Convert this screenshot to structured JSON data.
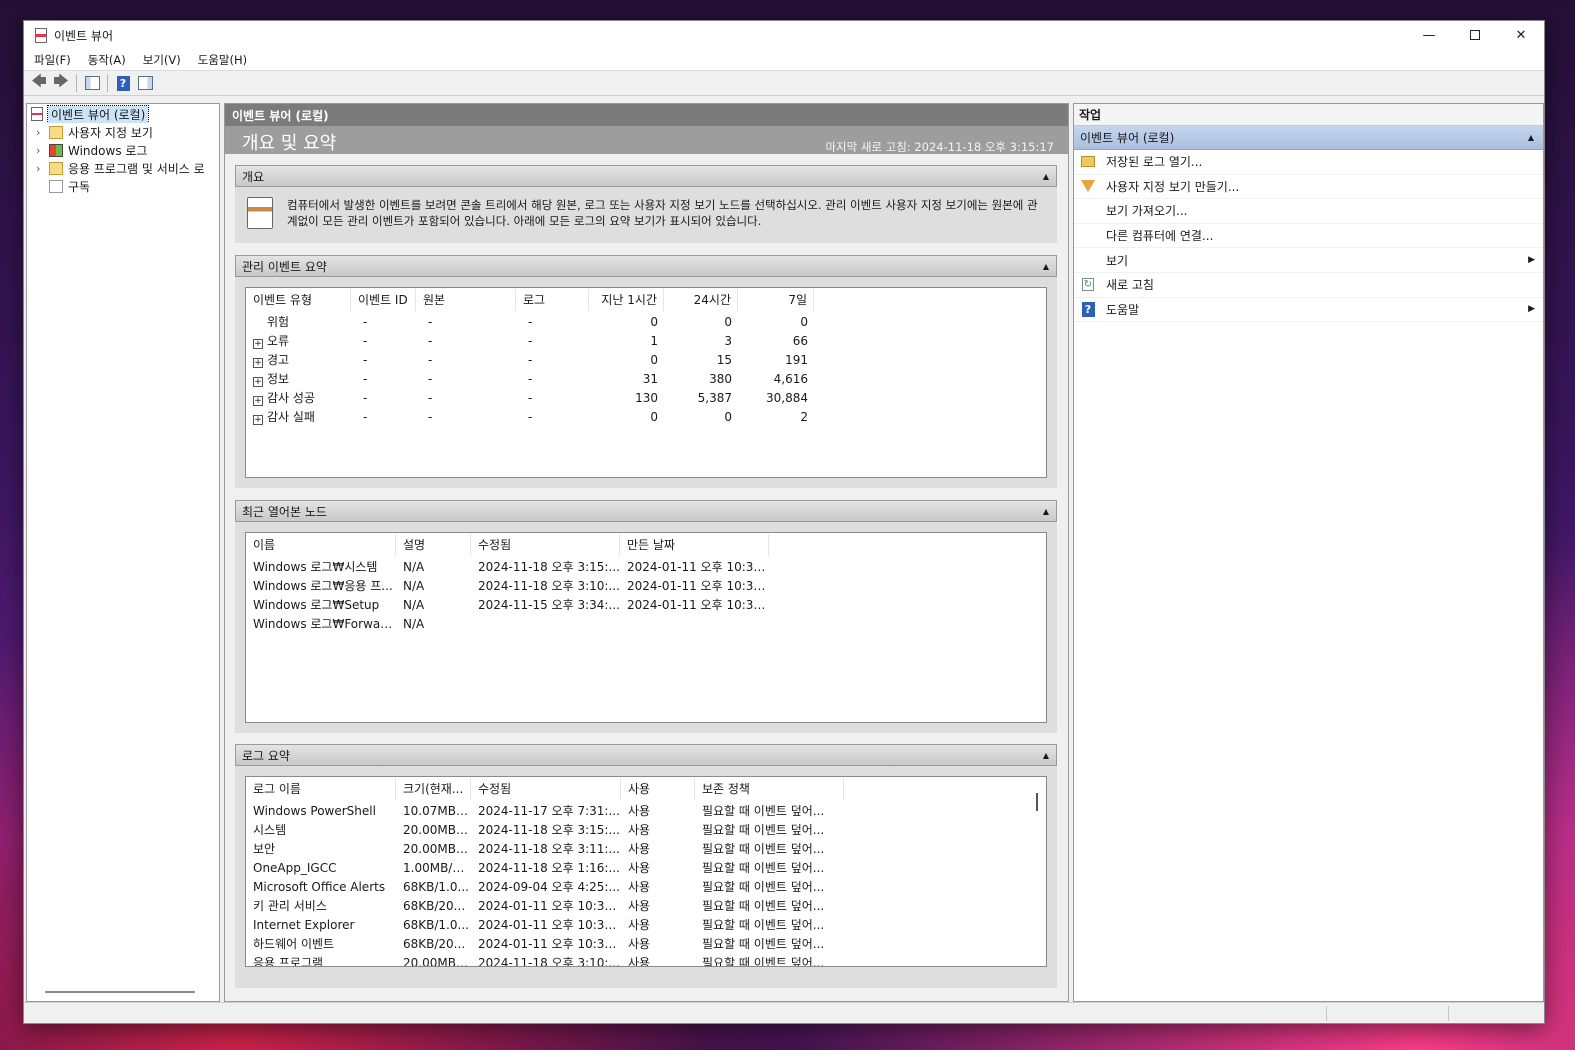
{
  "window": {
    "title": "이벤트 뷰어"
  },
  "menu": [
    "파일(F)",
    "동작(A)",
    "보기(V)",
    "도움말(H)"
  ],
  "tree": [
    {
      "label": "이벤트 뷰어 (로컬)",
      "selected": true,
      "icon": "event-viewer-icon"
    },
    {
      "label": "사용자 지정 보기",
      "icon": "folder-icon"
    },
    {
      "label": "Windows 로그",
      "icon": "windows-logs-icon"
    },
    {
      "label": "응용 프로그램 및 서비스 로",
      "icon": "folder-icon"
    },
    {
      "label": "구독",
      "icon": "subscription-icon"
    }
  ],
  "main": {
    "header": "이벤트 뷰어 (로컬)",
    "subtitle": "개요 및 요약",
    "last_refresh": "마지막 새로 고침: 2024-11-18 오후 3:15:17",
    "overview": {
      "title": "개요",
      "text": "컴퓨터에서 발생한 이벤트를 보려면 콘솔 트리에서 해당 원본, 로그 또는 사용자 지정 보기 노드를 선택하십시오. 관리 이벤트 사용자 지정 보기에는 원본에 관계없이 모든 관리 이벤트가 포함되어 있습니다. 아래에 모든 로그의 요약 보기가 표시되어 있습니다."
    },
    "admin_summary": {
      "title": "관리 이벤트 요약",
      "columns": [
        "이벤트 유형",
        "이벤트 ID",
        "원본",
        "로그",
        "지난 1시간",
        "24시간",
        "7일"
      ],
      "rows": [
        {
          "expand": false,
          "cells": [
            "위험",
            "-",
            "-",
            "-",
            "0",
            "0",
            "0"
          ]
        },
        {
          "expand": true,
          "cells": [
            "오류",
            "-",
            "-",
            "-",
            "1",
            "3",
            "66"
          ]
        },
        {
          "expand": true,
          "cells": [
            "경고",
            "-",
            "-",
            "-",
            "0",
            "15",
            "191"
          ]
        },
        {
          "expand": true,
          "cells": [
            "정보",
            "-",
            "-",
            "-",
            "31",
            "380",
            "4,616"
          ]
        },
        {
          "expand": true,
          "cells": [
            "감사 성공",
            "-",
            "-",
            "-",
            "130",
            "5,387",
            "30,884"
          ]
        },
        {
          "expand": true,
          "cells": [
            "감사 실패",
            "-",
            "-",
            "-",
            "0",
            "0",
            "2"
          ]
        }
      ]
    },
    "recent_nodes": {
      "title": "최근 열어본 노드",
      "columns": [
        "이름",
        "설명",
        "수정됨",
        "만든 날짜"
      ],
      "rows": [
        [
          "Windows 로그₩시스템",
          "N/A",
          "2024-11-18 오후 3:15:...",
          "2024-01-11 오후 10:34..."
        ],
        [
          "Windows 로그₩응용 프...",
          "N/A",
          "2024-11-18 오후 3:10:...",
          "2024-01-11 오후 10:34..."
        ],
        [
          "Windows 로그₩Setup",
          "N/A",
          "2024-11-15 오후 3:34:...",
          "2024-01-11 오후 10:36..."
        ],
        [
          "Windows 로그₩Forward...",
          "N/A",
          "",
          ""
        ]
      ]
    },
    "log_summary": {
      "title": "로그 요약",
      "columns": [
        "로그 이름",
        "크기(현재...",
        "수정됨",
        "사용",
        "보존 정책"
      ],
      "rows": [
        [
          "Windows PowerShell",
          "10.07MB/...",
          "2024-11-17 오후 7:31:...",
          "사용",
          "필요할 때 이벤트 덮어..."
        ],
        [
          "시스템",
          "20.00MB/...",
          "2024-11-18 오후 3:15:...",
          "사용",
          "필요할 때 이벤트 덮어..."
        ],
        [
          "보안",
          "20.00MB/...",
          "2024-11-18 오후 3:11:...",
          "사용",
          "필요할 때 이벤트 덮어..."
        ],
        [
          "OneApp_IGCC",
          "1.00MB/1...",
          "2024-11-18 오후 1:16:...",
          "사용",
          "필요할 때 이벤트 덮어..."
        ],
        [
          "Microsoft Office Alerts",
          "68KB/1.0...",
          "2024-09-04 오후 4:25:...",
          "사용",
          "필요할 때 이벤트 덮어..."
        ],
        [
          "키 관리 서비스",
          "68KB/20...",
          "2024-01-11 오후 10:36...",
          "사용",
          "필요할 때 이벤트 덮어..."
        ],
        [
          "Internet Explorer",
          "68KB/1.0...",
          "2024-01-11 오후 10:36...",
          "사용",
          "필요할 때 이벤트 덮어..."
        ],
        [
          "하드웨어 이벤트",
          "68KB/20...",
          "2024-01-11 오후 10:36...",
          "사용",
          "필요할 때 이벤트 덮어..."
        ],
        [
          "응용 프로그램",
          "20.00MB/...",
          "2024-11-18 오후 3:10:...",
          "사용",
          "필요할 때 이벤트 덮어..."
        ]
      ]
    }
  },
  "actions": {
    "header": "작업",
    "group": "이벤트 뷰어 (로컬)",
    "items": [
      {
        "label": "저장된 로그 열기...",
        "icon": "open-folder-icon"
      },
      {
        "label": "사용자 지정 보기 만들기...",
        "icon": "filter-icon"
      },
      {
        "label": "보기 가져오기...",
        "icon": ""
      },
      {
        "label": "다른 컴퓨터에 연결...",
        "icon": ""
      },
      {
        "label": "보기",
        "icon": "",
        "submenu": true
      },
      {
        "label": "새로 고침",
        "icon": "refresh-icon"
      },
      {
        "label": "도움말",
        "icon": "help-icon",
        "submenu": true
      }
    ]
  }
}
